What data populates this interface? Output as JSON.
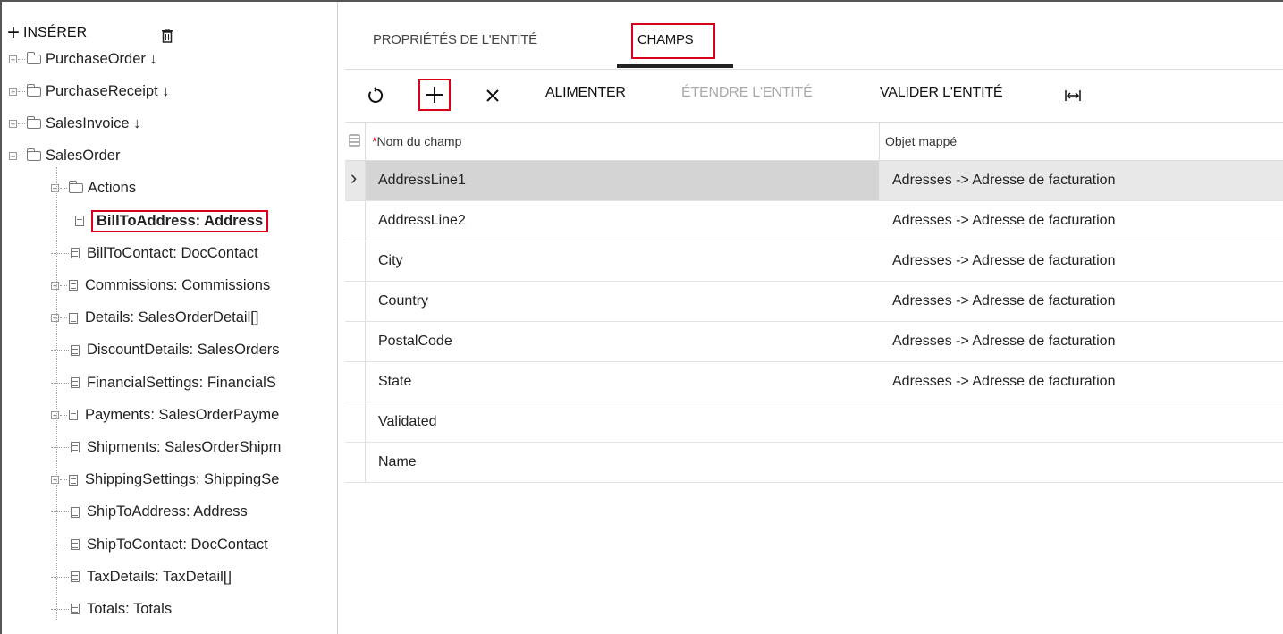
{
  "tree_toolbar": {
    "insert_label": "INSÉRER"
  },
  "tree": [
    {
      "label": "PurchaseOrder ↓",
      "kind": "folder",
      "level": 0,
      "expander": "+"
    },
    {
      "label": "PurchaseReceipt ↓",
      "kind": "folder",
      "level": 0,
      "expander": "+"
    },
    {
      "label": "SalesInvoice ↓",
      "kind": "folder",
      "level": 0,
      "expander": "+"
    },
    {
      "label": "SalesOrder",
      "kind": "folder",
      "level": 0,
      "expander": "−"
    },
    {
      "label": "Actions",
      "kind": "folder",
      "level": 1,
      "expander": "+"
    },
    {
      "label": "BillToAddress: Address",
      "kind": "doc",
      "level": 1,
      "expander": "",
      "selected": true
    },
    {
      "label": "BillToContact: DocContact",
      "kind": "doc",
      "level": 1,
      "expander": ""
    },
    {
      "label": "Commissions: Commissions",
      "kind": "doc",
      "level": 1,
      "expander": "+"
    },
    {
      "label": "Details: SalesOrderDetail[]",
      "kind": "doc",
      "level": 1,
      "expander": "+"
    },
    {
      "label": "DiscountDetails: SalesOrders",
      "kind": "doc",
      "level": 1,
      "expander": ""
    },
    {
      "label": "FinancialSettings: FinancialS",
      "kind": "doc",
      "level": 1,
      "expander": ""
    },
    {
      "label": "Payments: SalesOrderPayme",
      "kind": "doc",
      "level": 1,
      "expander": "+"
    },
    {
      "label": "Shipments: SalesOrderShipm",
      "kind": "doc",
      "level": 1,
      "expander": ""
    },
    {
      "label": "ShippingSettings: ShippingSe",
      "kind": "doc",
      "level": 1,
      "expander": "+"
    },
    {
      "label": "ShipToAddress: Address",
      "kind": "doc",
      "level": 1,
      "expander": ""
    },
    {
      "label": "ShipToContact: DocContact",
      "kind": "doc",
      "level": 1,
      "expander": ""
    },
    {
      "label": "TaxDetails: TaxDetail[]",
      "kind": "doc",
      "level": 1,
      "expander": ""
    },
    {
      "label": "Totals: Totals",
      "kind": "doc",
      "level": 1,
      "expander": ""
    }
  ],
  "tabs": {
    "properties": "PROPRIÉTÉS DE L'ENTITÉ",
    "fields": "CHAMPS",
    "active": "fields"
  },
  "toolbar": {
    "refresh_icon": "refresh-icon",
    "add_icon": "plus-icon",
    "delete_icon": "close-icon",
    "populate": "ALIMENTER",
    "extend": "ÉTENDRE L'ENTITÉ",
    "validate": "VALIDER L'ENTITÉ",
    "fit_icon": "fit-width-icon"
  },
  "grid": {
    "headers": {
      "required_mark": "*",
      "field_name": "Nom du champ",
      "mapped_object": "Objet mappé"
    },
    "rows": [
      {
        "field": "AddressLine1",
        "mapped": "Adresses -> Adresse de facturation",
        "active": true
      },
      {
        "field": "AddressLine2",
        "mapped": "Adresses -> Adresse de facturation"
      },
      {
        "field": "City",
        "mapped": "Adresses -> Adresse de facturation"
      },
      {
        "field": "Country",
        "mapped": "Adresses -> Adresse de facturation"
      },
      {
        "field": "PostalCode",
        "mapped": "Adresses -> Adresse de facturation"
      },
      {
        "field": "State",
        "mapped": "Adresses -> Adresse de facturation"
      },
      {
        "field": "Validated",
        "mapped": ""
      },
      {
        "field": "Name",
        "mapped": ""
      }
    ]
  },
  "colors": {
    "highlight": "#d9001b",
    "active_row": "#d4d4d4"
  }
}
